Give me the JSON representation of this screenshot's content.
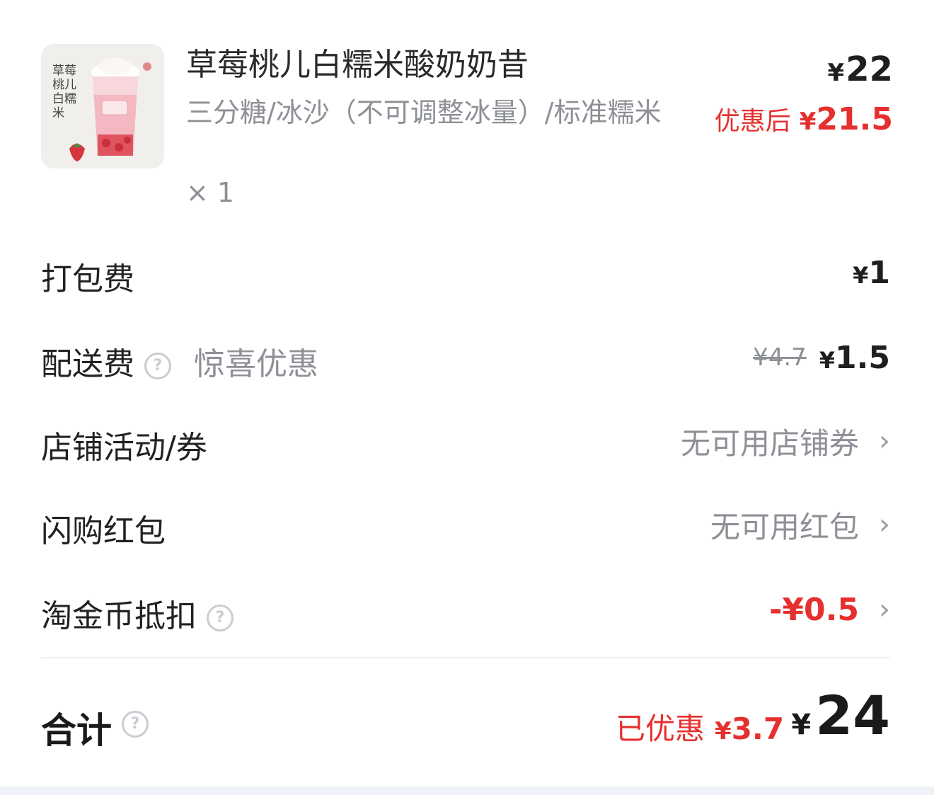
{
  "product": {
    "thumb_calligraphy": "草莓桃儿白糯米",
    "title": "草莓桃儿白糯米酸奶奶昔",
    "specs": "三分糖/冰沙（不可调整冰量）/标准糯米",
    "quantity": "× 1",
    "price_currency": "¥",
    "price": "22",
    "discount_label": "优惠后",
    "discount_currency": "¥",
    "discount_price": "21.5"
  },
  "fees": {
    "packing": {
      "label": "打包费",
      "currency": "¥",
      "amount": "1"
    },
    "delivery": {
      "label": "配送费",
      "promo": "惊喜优惠",
      "original": "¥4.7",
      "currency": "¥",
      "amount": "1.5"
    },
    "store_coupon": {
      "label": "店铺活动/券",
      "value": "无可用店铺券"
    },
    "flash_redpacket": {
      "label": "闪购红包",
      "value": "无可用红包"
    },
    "coins": {
      "label": "淘金币抵扣",
      "value": "-¥0.5"
    }
  },
  "total": {
    "label": "合计",
    "saved_label": "已优惠",
    "saved_currency": "¥",
    "saved_amount": "3.7",
    "currency": "¥",
    "amount": "24"
  },
  "colors": {
    "accent_red": "#e5302f",
    "muted_gray": "#8d9096"
  },
  "icons": {
    "help": "question-circle-icon",
    "chevron": "chevron-right-icon"
  }
}
